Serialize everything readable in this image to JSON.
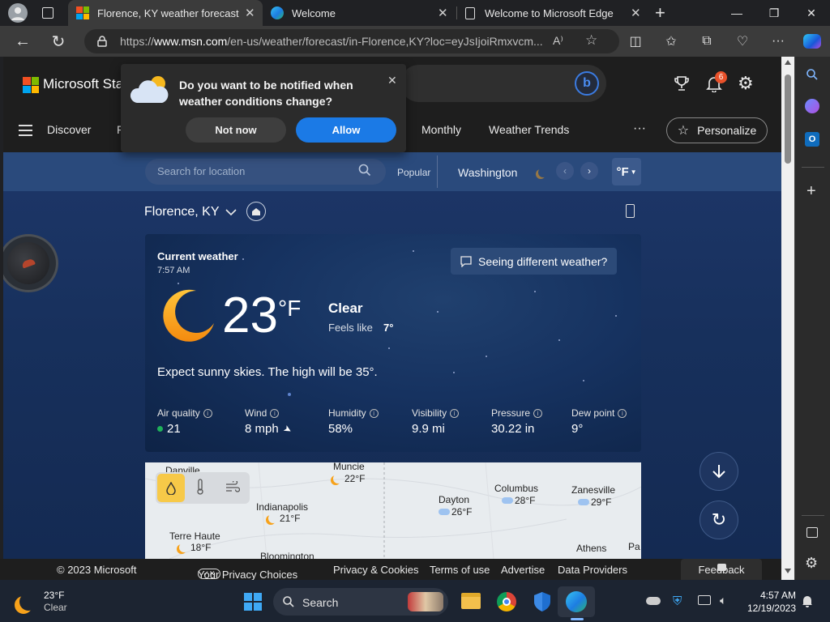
{
  "browser": {
    "tabs": [
      {
        "title": "Florence, KY weather forecast | M",
        "active": true
      },
      {
        "title": "Welcome",
        "active": false
      },
      {
        "title": "Welcome to Microsoft Edge",
        "active": false
      }
    ],
    "url_prefix": "https://",
    "url_domain": "www.msn.com",
    "url_rest": "/en-us/weather/forecast/in-Florence,KY?loc=eyJsIjoiRmxvcm..."
  },
  "msn": {
    "brand": "Microsoft Sta",
    "notif_count": "6",
    "nav": {
      "discover": "Discover",
      "f": "F",
      "monthly": "Monthly",
      "weather_trends": "Weather Trends",
      "more": "···",
      "personalize": "Personalize"
    }
  },
  "popup": {
    "question": "Do you want to be notified when weather conditions change?",
    "not_now": "Not now",
    "allow": "Allow"
  },
  "subbar": {
    "search_placeholder": "Search for location",
    "popular": "Popular",
    "city": "Washington",
    "unit": "°F"
  },
  "location": {
    "name": "Florence, KY"
  },
  "current": {
    "title": "Current weather",
    "time": "7:57 AM",
    "temp": "23",
    "unit": "°F",
    "condition": "Clear",
    "feels_label": "Feels like",
    "feels_value": "7°",
    "summary": "Expect sunny skies. The high will be 35°.",
    "different_btn": "Seeing different weather?",
    "stats": [
      {
        "label": "Air quality",
        "value": "21"
      },
      {
        "label": "Wind",
        "value": "8 mph"
      },
      {
        "label": "Humidity",
        "value": "58%"
      },
      {
        "label": "Visibility",
        "value": "9.9 mi"
      },
      {
        "label": "Pressure",
        "value": "30.22 in"
      },
      {
        "label": "Dew point",
        "value": "9°"
      }
    ]
  },
  "map": {
    "cities": [
      {
        "name": "Danville"
      },
      {
        "name": "Muncie",
        "temp": "22°F"
      },
      {
        "name": "Indianapolis",
        "temp": "21°F"
      },
      {
        "name": "Terre Haute",
        "temp": "18°F"
      },
      {
        "name": "Bloomington"
      },
      {
        "name": "Dayton",
        "temp": "26°F"
      },
      {
        "name": "Columbus",
        "temp": "28°F"
      },
      {
        "name": "Zanesville",
        "temp": "29°F"
      },
      {
        "name": "Athens"
      },
      {
        "name": "Pa"
      }
    ]
  },
  "footer": {
    "copyright": "© 2023 Microsoft",
    "privacy_choices": "Your Privacy Choices",
    "privacy_cookies": "Privacy & Cookies",
    "terms": "Terms of use",
    "advertise": "Advertise",
    "data_providers": "Data Providers",
    "feedback": "Feedback"
  },
  "taskbar": {
    "weather_temp": "23°F",
    "weather_cond": "Clear",
    "search": "Search",
    "time": "4:57 AM",
    "date": "12/19/2023"
  },
  "colors": {
    "accent": "#1a73e8",
    "allow_btn": "#1b7ae6",
    "air_quality_dot": "#1fb15a",
    "moon": "#f7a21b"
  }
}
